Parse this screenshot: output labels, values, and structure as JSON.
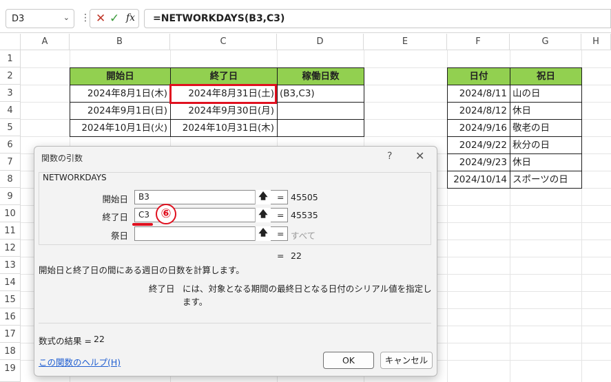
{
  "formula_bar": {
    "name_box": "D3",
    "name_box_caret": "⌄",
    "more_icon": "⋮",
    "cancel_icon": "✕",
    "enter_icon": "✓",
    "fx_label": "fx",
    "formula": "=NETWORKDAYS(B3,C3)"
  },
  "columns": [
    "A",
    "B",
    "C",
    "D",
    "E",
    "F",
    "G",
    "H"
  ],
  "rows": [
    "1",
    "2",
    "3",
    "4",
    "5",
    "6",
    "7",
    "8",
    "9",
    "10",
    "11",
    "12",
    "13",
    "14",
    "15",
    "16",
    "17",
    "18",
    "19"
  ],
  "table1": {
    "headers": [
      "開始日",
      "終了日",
      "稼働日数"
    ],
    "rows": [
      {
        "start": "2024年8月1日(木)",
        "end": "2024年8月31日(土)",
        "days": "(B3,C3)"
      },
      {
        "start": "2024年9月1日(日)",
        "end": "2024年9月30日(月)",
        "days": ""
      },
      {
        "start": "2024年10月1日(火)",
        "end": "2024年10月31日(木)",
        "days": ""
      }
    ]
  },
  "table2": {
    "headers": [
      "日付",
      "祝日"
    ],
    "rows": [
      {
        "date": "2024/8/11",
        "name": "山の日"
      },
      {
        "date": "2024/8/12",
        "name": "休日"
      },
      {
        "date": "2024/9/16",
        "name": "敬老の日"
      },
      {
        "date": "2024/9/22",
        "name": "秋分の日"
      },
      {
        "date": "2024/9/23",
        "name": "休日"
      },
      {
        "date": "2024/10/14",
        "name": "スポーツの日"
      }
    ]
  },
  "dialog": {
    "title": "関数の引数",
    "help_icon": "?",
    "close_icon": "✕",
    "function_name": "NETWORKDAYS",
    "args": [
      {
        "label": "開始日",
        "value": "B3",
        "eq": "=",
        "result": "45505"
      },
      {
        "label": "終了日",
        "value": "C3",
        "eq": "=",
        "result": "45535"
      },
      {
        "label": "祭日",
        "value": "",
        "eq": "=",
        "result": "すべて"
      }
    ],
    "collapse_icon": "🡅",
    "total_eq": "=",
    "total_result": "22",
    "description": "開始日と終了日の間にある週日の日数を計算します。",
    "arg_help_name": "終了日",
    "arg_help_text": "には、対象となる期間の最終日となる日付のシリアル値を指定します。",
    "formula_result_label": "数式の結果 =",
    "formula_result_value": "22",
    "help_link": "この関数のヘルプ(H)",
    "ok_label": "OK",
    "cancel_label": "キャンセル",
    "annotation_badge": "⑥"
  }
}
